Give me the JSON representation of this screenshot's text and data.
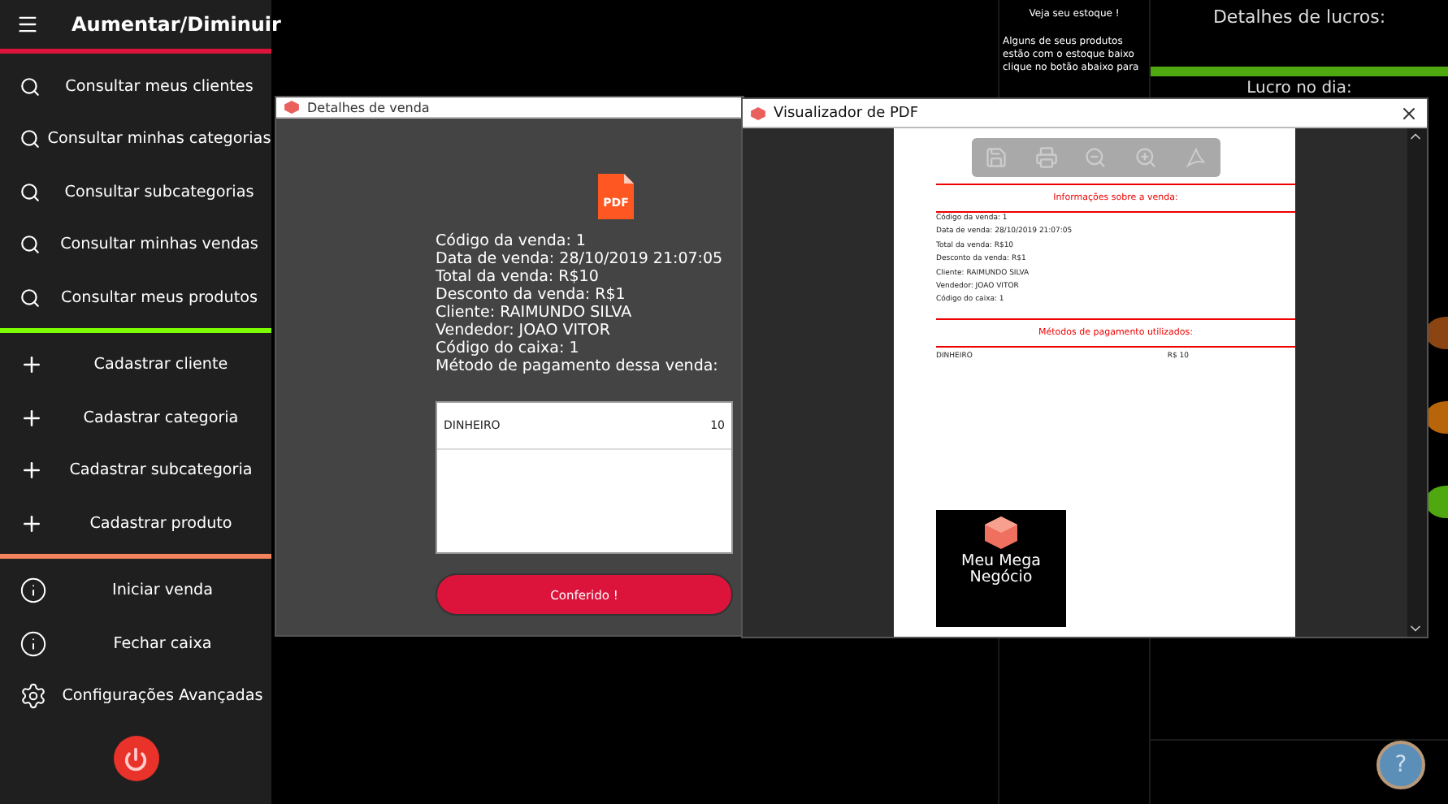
{
  "sidebar": {
    "title": "Aumentar/Diminuir",
    "sections": [
      {
        "color": "#dc143c",
        "items": [
          {
            "kind": "search",
            "label": "Consultar meus clientes"
          },
          {
            "kind": "search",
            "label": "Consultar minhas categorias"
          },
          {
            "kind": "search",
            "label": "Consultar subcategorias"
          },
          {
            "kind": "search",
            "label": "Consultar minhas vendas"
          },
          {
            "kind": "search",
            "label": "Consultar meus produtos"
          }
        ]
      },
      {
        "color": "#7cfc00",
        "items": [
          {
            "kind": "plus",
            "label": "Cadastrar cliente"
          },
          {
            "kind": "plus",
            "label": "Cadastrar categoria"
          },
          {
            "kind": "plus",
            "label": "Cadastrar subcategoria"
          },
          {
            "kind": "plus",
            "label": "Cadastrar produto"
          }
        ]
      },
      {
        "color": "#f4845f",
        "items": [
          {
            "kind": "info",
            "label": "Iniciar venda"
          },
          {
            "kind": "info",
            "label": "Fechar caixa"
          },
          {
            "kind": "gear",
            "label": "Configurações Avançadas"
          }
        ]
      }
    ]
  },
  "stock_panel": {
    "title": "Veja seu estoque !",
    "message": "Alguns de seus produtos estão com o estoque baixo clique no botão abaixo para"
  },
  "profit_panel": {
    "title": "Detalhes de lucros:",
    "subtitle": "Lucro no dia:"
  },
  "help_button": {
    "label": "?"
  },
  "status_dots": [
    {
      "color": "#8b4513"
    },
    {
      "color": "#b8650a"
    },
    {
      "color": "#4fa80f"
    }
  ],
  "sale_window": {
    "title": "Detalhes de venda",
    "file_label": "PDF",
    "lines": [
      "Código da venda: 1",
      "Data de venda: 28/10/2019 21:07:05",
      "Total da venda: R$10",
      "Desconto da venda: R$1",
      "Cliente: RAIMUNDO SILVA",
      "Vendedor: JOAO VITOR",
      "Código do caixa: 1",
      "Método de pagamento dessa venda:"
    ],
    "payments": [
      {
        "method": "DINHEIRO",
        "amount": "10"
      }
    ],
    "button": "Conferido !"
  },
  "pdf_window": {
    "title": "Visualizador de PDF",
    "document": {
      "heading": "Informações sobre a venda:",
      "lines": [
        "Código da venda: 1",
        "Data de venda: 28/10/2019 21:07:05",
        "Total da venda: R$10",
        "Desconto da venda: R$1",
        "Cliente: RAIMUNDO SILVA",
        "Vendedor: JOAO VITOR",
        "Código do caixa: 1"
      ],
      "payments_heading": "Métodos de pagamento utilizados:",
      "payments": [
        {
          "method": "DINHEIRO",
          "amount": "R$ 10"
        }
      ],
      "logo_text": "Meu Mega Negócio"
    }
  }
}
